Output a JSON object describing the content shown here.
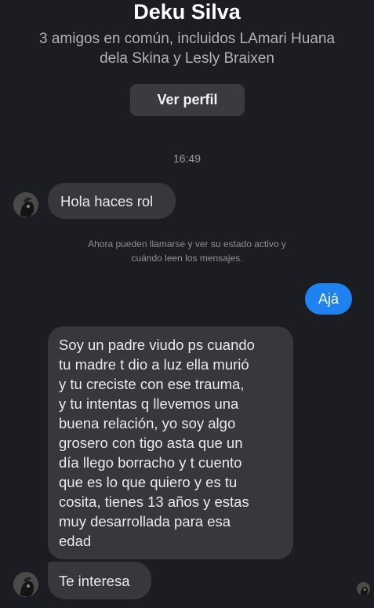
{
  "header": {
    "contact_name": "Deku Silva",
    "mutual_friends": [
      "3 amigos en común, incluidos LAmari Huana",
      "dela Skina y Lesly Braixen"
    ],
    "view_profile_label": "Ver perfil"
  },
  "conversation": {
    "timestamp": "16:49",
    "messages": [
      {
        "sender": "contact",
        "lines": [
          "Hola haces rol"
        ]
      },
      {
        "sender": "me",
        "lines": [
          "Ajá"
        ]
      },
      {
        "sender": "contact",
        "lines": [
          "Soy un padre viudo ps cuando",
          "tu madre t dio a luz ella murió",
          "y tu creciste con ese trauma,",
          "y tu intentas q llevemos una",
          "buena relación, yo soy algo",
          "grosero con tigo asta que un",
          "día llego borracho y t cuento",
          "que es lo que quiero y es tu",
          "cosita, tienes 13 años y estas",
          "muy desarrollada para esa",
          "edad"
        ]
      },
      {
        "sender": "contact",
        "lines": [
          "Te interesa"
        ]
      }
    ],
    "notice": [
      "Ahora pueden llamarse y ver su estado activo y",
      "cuándo leen los mensajes."
    ]
  },
  "icons": {
    "contact_avatar": "avatar-icon",
    "seen_indicator": "seen-avatar-icon"
  },
  "colors": {
    "background": "#1c1d22",
    "incoming_bubble": "#37383d",
    "outgoing_bubble": "#1e82f0",
    "profile_button": "#3a3b3f"
  }
}
